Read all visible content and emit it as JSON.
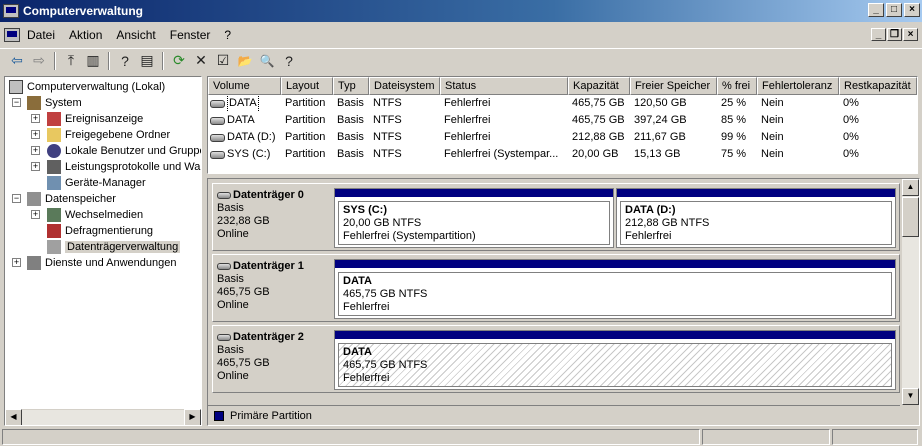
{
  "window": {
    "title": "Computerverwaltung",
    "controls": {
      "minimize": "_",
      "maximize": "□",
      "close": "×"
    }
  },
  "menu": {
    "items": [
      "Datei",
      "Aktion",
      "Ansicht",
      "Fenster",
      "?"
    ],
    "mdi_controls": {
      "minimize": "_",
      "restore": "❐",
      "close": "×"
    }
  },
  "toolbar": {
    "icons": [
      "back-icon",
      "forward-icon",
      "up-folder-icon",
      "show-hide-tree-icon",
      "help-icon",
      "properties-icon",
      "refresh-icon",
      "delete-icon",
      "settings-icon",
      "open-icon",
      "search-icon",
      "help-topics-icon"
    ],
    "glyphs": [
      "⇦",
      "⇨",
      "⤒",
      "▥",
      "?",
      "▤",
      "⟳",
      "✕",
      "☑",
      "📂",
      "🔍",
      "?"
    ]
  },
  "tree": {
    "root": "Computerverwaltung (Lokal)",
    "system": "System",
    "ereignis": "Ereignisanzeige",
    "freigaben": "Freigegebene Ordner",
    "benutzer": "Lokale Benutzer und Gruppe",
    "leistung": "Leistungsprotokolle und War",
    "geraete": "Geräte-Manager",
    "datenspeicher": "Datenspeicher",
    "wechselmedien": "Wechselmedien",
    "defrag": "Defragmentierung",
    "datentraeger": "Datenträgerverwaltung",
    "dienste": "Dienste und Anwendungen",
    "expand_minus": "−",
    "expand_plus": "+"
  },
  "volumes": {
    "headers": [
      "Volume",
      "Layout",
      "Typ",
      "Dateisystem",
      "Status",
      "Kapazität",
      "Freier Speicher",
      "% frei",
      "Fehlertoleranz",
      "Restkapazität"
    ],
    "rows": [
      [
        "DATA",
        "Partition",
        "Basis",
        "NTFS",
        "Fehlerfrei",
        "465,75 GB",
        "120,50 GB",
        "25 %",
        "Nein",
        "0%"
      ],
      [
        "DATA",
        "Partition",
        "Basis",
        "NTFS",
        "Fehlerfrei",
        "465,75 GB",
        "397,24 GB",
        "85 %",
        "Nein",
        "0%"
      ],
      [
        "DATA (D:)",
        "Partition",
        "Basis",
        "NTFS",
        "Fehlerfrei",
        "212,88 GB",
        "211,67 GB",
        "99 %",
        "Nein",
        "0%"
      ],
      [
        "SYS (C:)",
        "Partition",
        "Basis",
        "NTFS",
        "Fehlerfrei (Systempar...",
        "20,00 GB",
        "15,13 GB",
        "75 %",
        "Nein",
        "0%"
      ]
    ]
  },
  "disks": [
    {
      "name": "Datenträger 0",
      "type": "Basis",
      "size": "232,88 GB",
      "status": "Online",
      "partitions": [
        {
          "name": "SYS  (C:)",
          "size": "20,00 GB NTFS",
          "status": "Fehlerfrei (Systempartition)"
        },
        {
          "name": "DATA  (D:)",
          "size": "212,88 GB NTFS",
          "status": "Fehlerfrei"
        }
      ]
    },
    {
      "name": "Datenträger 1",
      "type": "Basis",
      "size": "465,75 GB",
      "status": "Online",
      "partitions": [
        {
          "name": "DATA",
          "size": "465,75 GB NTFS",
          "status": "Fehlerfrei"
        }
      ]
    },
    {
      "name": "Datenträger 2",
      "type": "Basis",
      "size": "465,75 GB",
      "status": "Online",
      "partitions": [
        {
          "name": "DATA",
          "size": "465,75 GB NTFS",
          "status": "Fehlerfrei"
        }
      ]
    }
  ],
  "legend": {
    "primary": "Primäre Partition"
  },
  "scroll": {
    "up": "▲",
    "down": "▼",
    "left": "◀",
    "right": "▶"
  },
  "colors": {
    "primary_partition": "#000080",
    "title_bar": "#0a246a"
  }
}
